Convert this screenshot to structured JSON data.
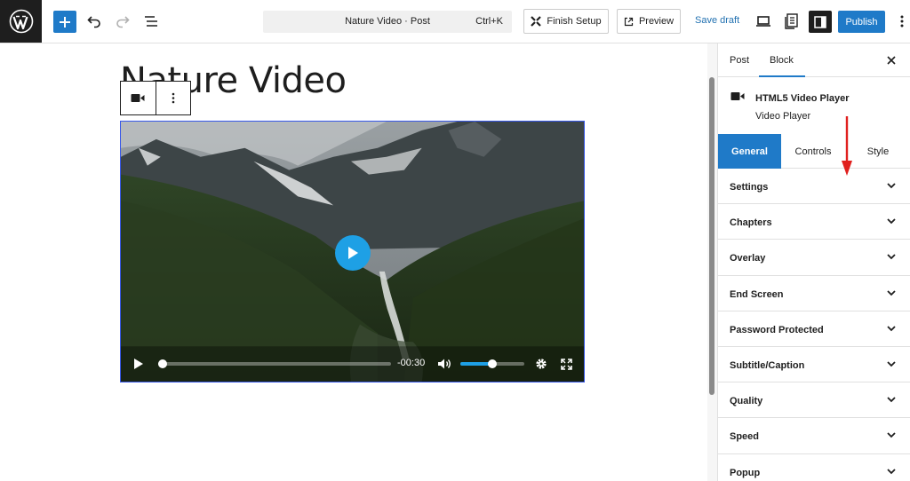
{
  "topbar": {
    "command_title": "Nature Video · Post",
    "command_shortcut": "Ctrl+K",
    "finish_setup_label": "Finish Setup",
    "preview_label": "Preview",
    "save_draft_label": "Save draft",
    "publish_label": "Publish"
  },
  "editor": {
    "post_title": "Nature Video",
    "video": {
      "time_remaining": "-00:30",
      "progress": 0.02,
      "volume": 0.5
    }
  },
  "sidebar": {
    "tabs": [
      {
        "label": "Post",
        "active": false
      },
      {
        "label": "Block",
        "active": true
      }
    ],
    "block": {
      "title": "HTML5 Video Player",
      "description": "Video Player"
    },
    "panel_tabs": [
      {
        "label": "General",
        "active": true
      },
      {
        "label": "Controls",
        "active": false
      },
      {
        "label": "Style",
        "active": false
      }
    ],
    "sections": [
      {
        "label": "Settings"
      },
      {
        "label": "Chapters"
      },
      {
        "label": "Overlay"
      },
      {
        "label": "End Screen"
      },
      {
        "label": "Password Protected"
      },
      {
        "label": "Subtitle/Caption"
      },
      {
        "label": "Quality"
      },
      {
        "label": "Speed"
      },
      {
        "label": "Popup"
      }
    ]
  },
  "colors": {
    "accent": "#1f7ac8",
    "annotation_arrow": "#e0201e",
    "player_accent": "#1ea0e5"
  }
}
